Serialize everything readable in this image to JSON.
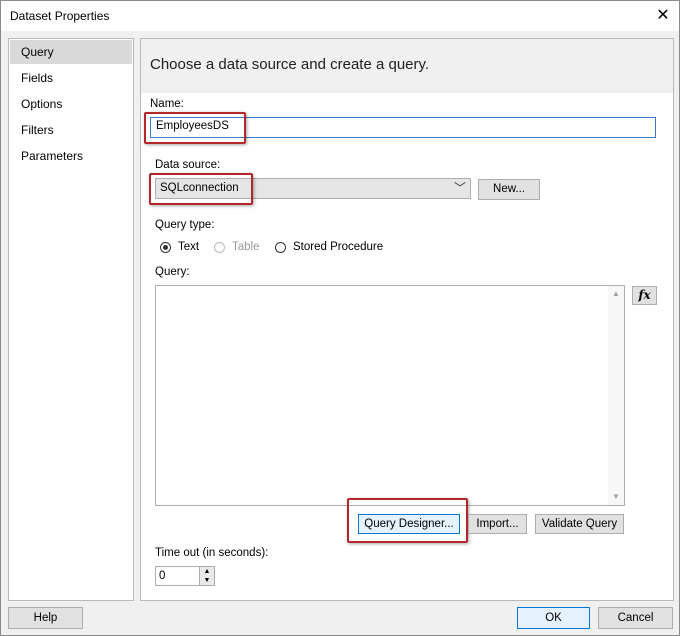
{
  "window": {
    "title": "Dataset Properties"
  },
  "nav": {
    "items": [
      {
        "label": "Query",
        "selected": true
      },
      {
        "label": "Fields",
        "selected": false
      },
      {
        "label": "Options",
        "selected": false
      },
      {
        "label": "Filters",
        "selected": false
      },
      {
        "label": "Parameters",
        "selected": false
      }
    ]
  },
  "main": {
    "heading": "Choose a data source and create a query.",
    "name_label": "Name:",
    "name_value": "EmployeesDS",
    "datasource_label": "Data source:",
    "datasource_value": "SQLconnection",
    "new_button": "New...",
    "query_type_label": "Query type:",
    "query_types": [
      {
        "label": "Text",
        "checked": true,
        "disabled": false
      },
      {
        "label": "Table",
        "checked": false,
        "disabled": true
      },
      {
        "label": "Stored Procedure",
        "checked": false,
        "disabled": false
      }
    ],
    "query_label": "Query:",
    "query_value": "",
    "expression_button": "fx",
    "query_designer_button": "Query Designer...",
    "import_button": "Import...",
    "validate_button": "Validate Query",
    "timeout_label": "Time out (in seconds):",
    "timeout_value": "0"
  },
  "footer": {
    "help_button": "Help",
    "ok_button": "OK",
    "cancel_button": "Cancel"
  },
  "icons": {
    "close": "close-icon",
    "dropdown": "chevron-down-icon",
    "expression": "fx-icon"
  },
  "colors": {
    "highlight": "#b4262b",
    "focus": "#0078d7"
  }
}
